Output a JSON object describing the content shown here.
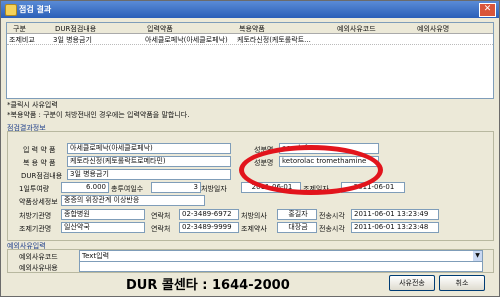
{
  "title": "점검 결과",
  "table": {
    "headers": [
      "구분",
      "DUR점검내용",
      "입력약품",
      "복용약품",
      "예외사유코드",
      "예외사유명"
    ],
    "row": [
      "조제비교",
      "3일 병용금기",
      "아세클로페낙(아세클로페낙)",
      "케토라신정(케토롤락트...",
      "",
      ""
    ]
  },
  "notes": [
    "*클릭시 사유입력",
    "*복용약품 : 구분이 처방전내인 경우에는 입력약품을 말합니다."
  ],
  "section_detail": "점검결과정보",
  "detail": {
    "input_drug_label": "입 력 약 품",
    "input_drug_value": "아세클로페낙(아세클로페낙)",
    "ingredient_label": "성분명",
    "ingredient_value_1": "aceclofenac",
    "taking_drug_label": "복 용 약 품",
    "taking_drug_value": "케토라신정(케토롤락트로메타민)",
    "ingredient_value_2": "ketorolac tromethamine",
    "dur_label": "DUR점검내용",
    "dur_value": "3일 병용금기",
    "daily_label": "1일투여량",
    "daily_value": "6.000",
    "total_days_label": "총투여일수",
    "total_days_value": "3",
    "rx_date_label": "처방일자",
    "rx_date_value": "2011-06-01",
    "dispense_date_label": "조제일자",
    "dispense_date_value": "2011-06-01",
    "side_label": "약품상세정보",
    "side_value": "중증의 위장관계 이상반응",
    "rx_org_label": "처방기관명",
    "rx_org_value": "종합병원",
    "contact_label": "연락처",
    "rx_phone": "02-3489-6972",
    "doctor_label": "처방의사",
    "doctor_value": "홍길자",
    "send_time_label": "전송시각",
    "rx_time": "2011-06-01 13:23:49",
    "disp_org_label": "조제기관명",
    "disp_org_value": "일산약국",
    "disp_phone": "02-3489-9999",
    "pharm_label": "조제약사",
    "pharm_value": "대장금",
    "disp_time": "2011-06-01 13:23:48"
  },
  "section_exception": "예외사유입력",
  "exception": {
    "code_label": "예외사유코드",
    "code_value": "Text입력",
    "content_label": "예외사유내용",
    "content_value": ""
  },
  "footer": "DUR 콜센타 : 1644-2000",
  "buttons": {
    "submit": "사유전송",
    "cancel": "취소"
  },
  "colors": {
    "highlight": "#e2141c",
    "title_bar": "#2a5fb8"
  }
}
